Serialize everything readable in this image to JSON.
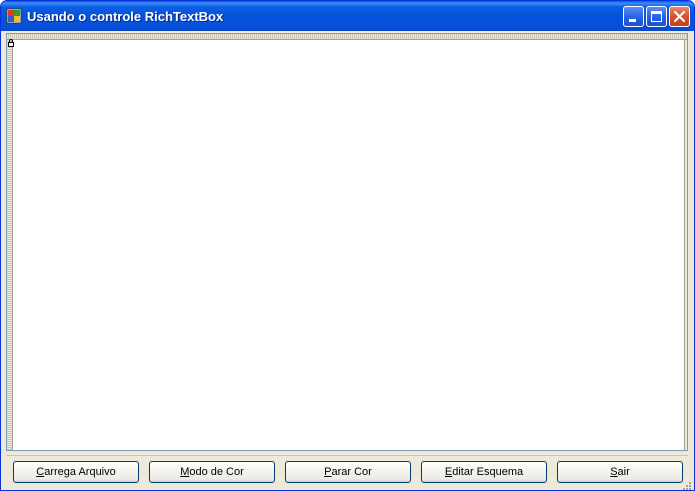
{
  "window": {
    "title": "Usando o controle RichTextBox"
  },
  "rich_text_box": {
    "value": ""
  },
  "buttons": [
    {
      "mnemonic": "C",
      "rest": "arrega Arquivo"
    },
    {
      "mnemonic": "M",
      "rest": "odo de Cor"
    },
    {
      "mnemonic": "P",
      "rest": "arar Cor"
    },
    {
      "mnemonic": "E",
      "rest": "ditar Esquema"
    },
    {
      "mnemonic": "S",
      "rest": "air"
    }
  ],
  "icons": {
    "app": "app-icon",
    "minimize": "minimize-icon",
    "maximize": "maximize-icon",
    "close": "close-icon",
    "lock": "lock-icon",
    "grip": "resize-grip-icon"
  },
  "colors": {
    "titlebar": "#0453d8",
    "face": "#ece9d8",
    "button_border": "#003c74",
    "close": "#d8512c"
  }
}
